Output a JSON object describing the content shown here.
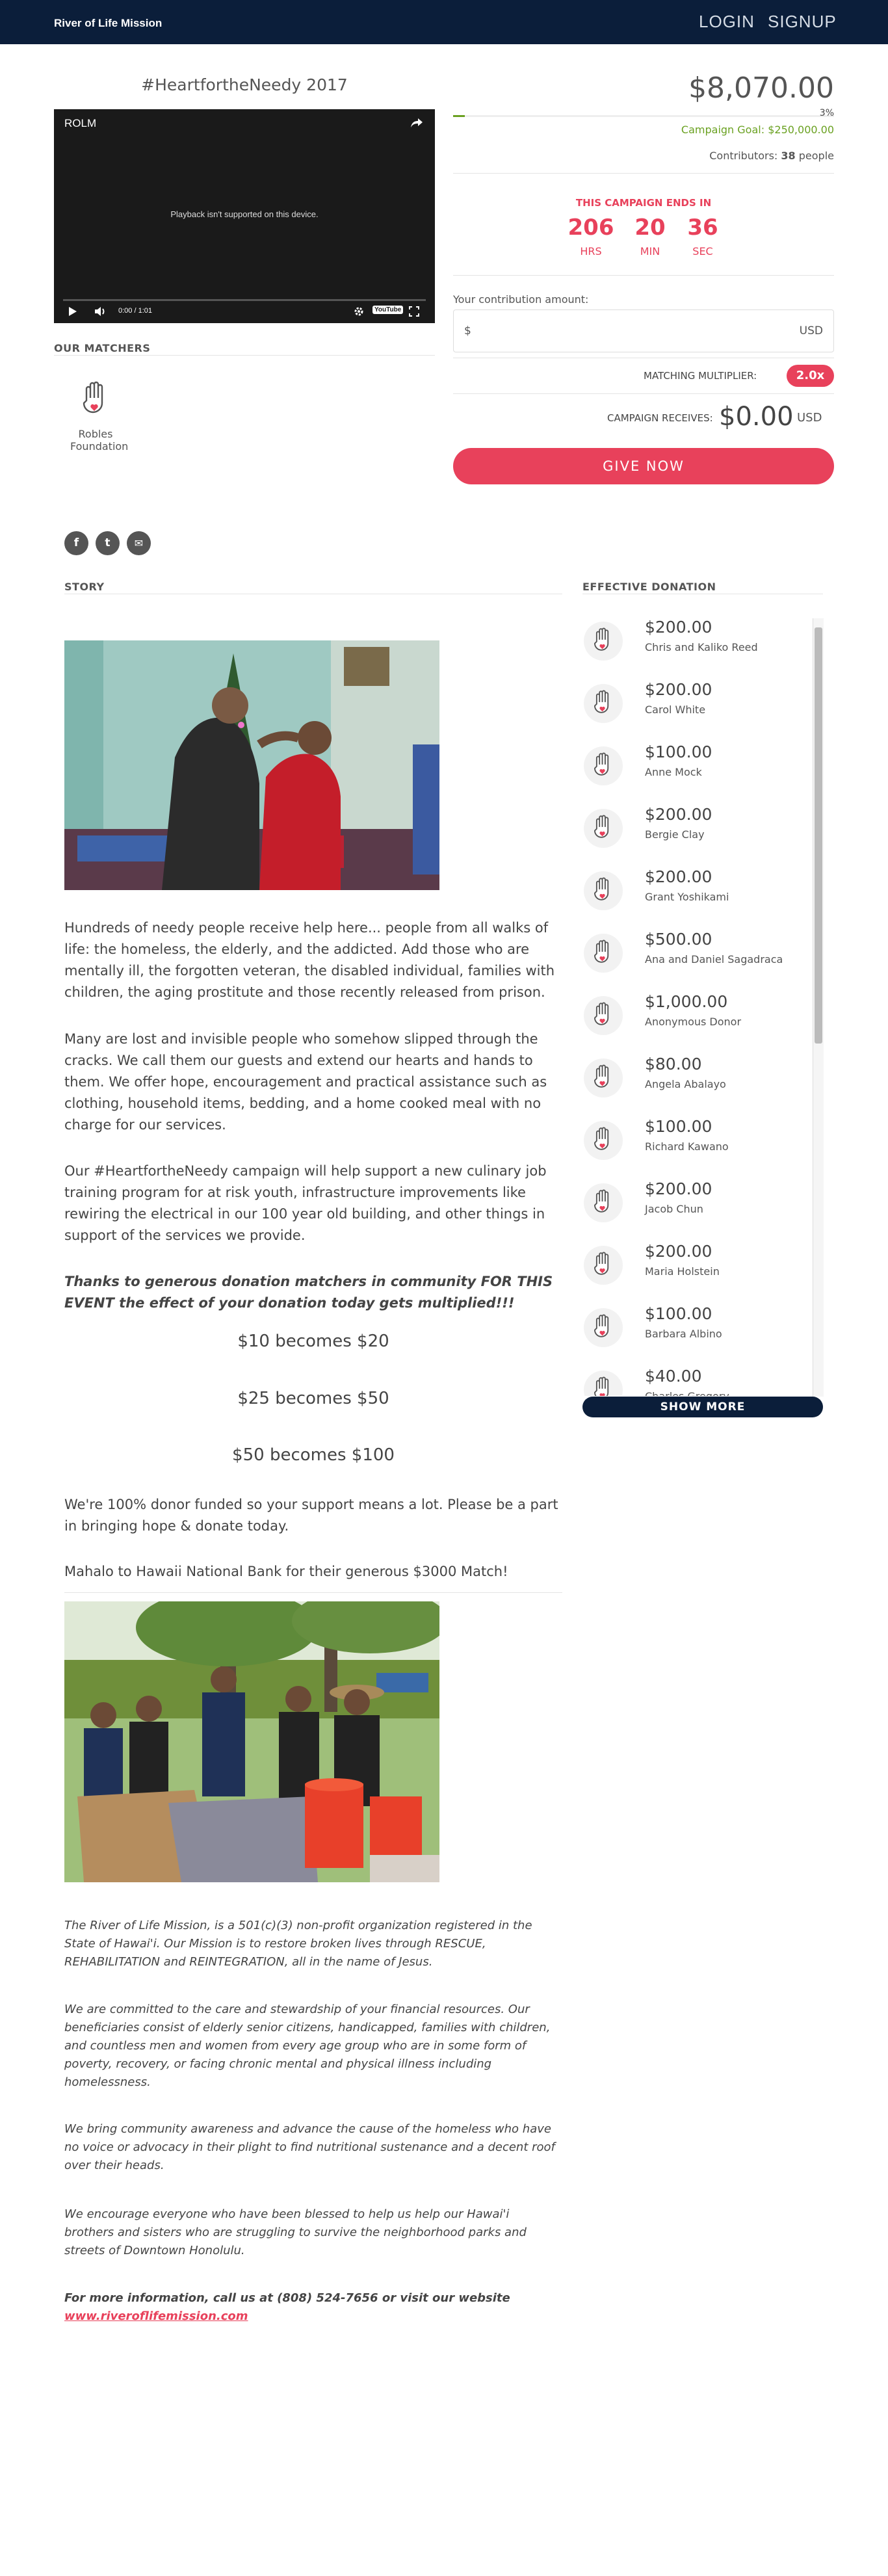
{
  "header": {
    "brand": "River of Life Mission",
    "login": "LOGIN",
    "signup": "SIGNUP"
  },
  "campaign": {
    "title": "#HeartfortheNeedy 2017",
    "raised": "$8,070.00",
    "percent_label": "3%",
    "percent": 3,
    "goal_label": "Campaign Goal:",
    "goal": "$250,000.00",
    "contributors_label": "Contributors:",
    "contributors": "38",
    "contributors_unit": "people"
  },
  "video": {
    "channel": "ROLM",
    "message": "Playback isn't supported on this device.",
    "time": "0:00 / 1:01",
    "youtube": "YouTube"
  },
  "matchers": {
    "heading": "OUR MATCHERS",
    "items": [
      {
        "name": "Robles Foundation"
      }
    ]
  },
  "countdown": {
    "label": "THIS CAMPAIGN ENDS IN",
    "hrs": "206",
    "hrs_label": "HRS",
    "min": "20",
    "min_label": "MIN",
    "sec": "36",
    "sec_label": "SEC"
  },
  "contribution": {
    "label": "Your contribution amount:",
    "prefix": "$",
    "currency": "USD",
    "multiplier_label": "MATCHING MULTIPLIER:",
    "multiplier": "2.0x",
    "receives_label": "CAMPAIGN RECEIVES:",
    "receives_value": "$0.00",
    "receives_currency": "USD",
    "give_button": "GIVE NOW"
  },
  "social": {
    "facebook": "f",
    "twitter": "t",
    "email": "✉"
  },
  "story": {
    "heading": "STORY",
    "p1": "Hundreds of needy people receive help here... people from all walks of life: the homeless, the elderly, and the addicted. Add those who are mentally ill, the forgotten veteran, the disabled individual, families with children, the aging prostitute and those recently released from prison.",
    "p2": "Many are lost and invisible people who somehow slipped through the cracks. We call them our guests and extend our hearts and hands to them. We offer hope, encouragement and practical assistance such as clothing, household items, bedding, and a home cooked meal with no charge for our services.",
    "p3": "Our #HeartfortheNeedy campaign will help support a new culinary job training program for at risk youth, infrastructure improvements like rewiring the electrical in our 100 year old building, and other things in support of the services we provide.",
    "p4": "Thanks to generous donation matchers in community FOR THIS EVENT the effect of your donation today gets multiplied!!!",
    "m1": "$10 becomes $20",
    "m2": "$25 becomes $50",
    "m3": "$50 becomes $100",
    "p5": "We're 100% donor funded so your support means a lot. Please be a part in bringing hope & donate today.",
    "p6": "Mahalo to Hawaii National Bank for their generous $3000 Match!",
    "f1": "The River of Life Mission, is a 501(c)(3) non-profit organization registered in the State of Hawai'i. Our Mission is to restore broken lives through RESCUE, REHABILITATION and REINTEGRATION, all in the name of Jesus.",
    "f2": "We are committed to the care and stewardship of your financial resources. Our beneficiaries consist of elderly senior citizens, handicapped, families with children, and countless men and women from every age group who are in some form of poverty, recovery, or facing chronic mental and physical illness including homelessness.",
    "f3": "We bring community awareness and advance the cause of the homeless who have no voice or advocacy in their plight to find nutritional sustenance and a decent roof over their heads.",
    "f4": "We encourage everyone who have been blessed to help us help our Hawai'i brothers and sisters who are struggling to survive the neighborhood parks and streets of Downtown Honolulu.",
    "f5": "For more information, call us at (808) 524-7656 or visit our website",
    "link": "www.riveroflifemission.com"
  },
  "donations": {
    "heading": "EFFECTIVE DONATION",
    "show_more": "SHOW MORE",
    "items": [
      {
        "amount": "$200.00",
        "name": "Chris and Kaliko Reed"
      },
      {
        "amount": "$200.00",
        "name": "Carol White"
      },
      {
        "amount": "$100.00",
        "name": "Anne Mock"
      },
      {
        "amount": "$200.00",
        "name": "Bergie Clay"
      },
      {
        "amount": "$200.00",
        "name": "Grant Yoshikami"
      },
      {
        "amount": "$500.00",
        "name": "Ana and Daniel Sagadraca"
      },
      {
        "amount": "$1,000.00",
        "name": "Anonymous Donor"
      },
      {
        "amount": "$80.00",
        "name": "Angela Abalayo"
      },
      {
        "amount": "$100.00",
        "name": "Richard Kawano"
      },
      {
        "amount": "$200.00",
        "name": "Jacob Chun"
      },
      {
        "amount": "$200.00",
        "name": "Maria Holstein"
      },
      {
        "amount": "$100.00",
        "name": "Barbara Albino"
      },
      {
        "amount": "$40.00",
        "name": "Charles Gregory"
      }
    ]
  },
  "colors": {
    "navy": "#0b1e3a",
    "accent": "#e8415b",
    "green": "#6aa121"
  }
}
